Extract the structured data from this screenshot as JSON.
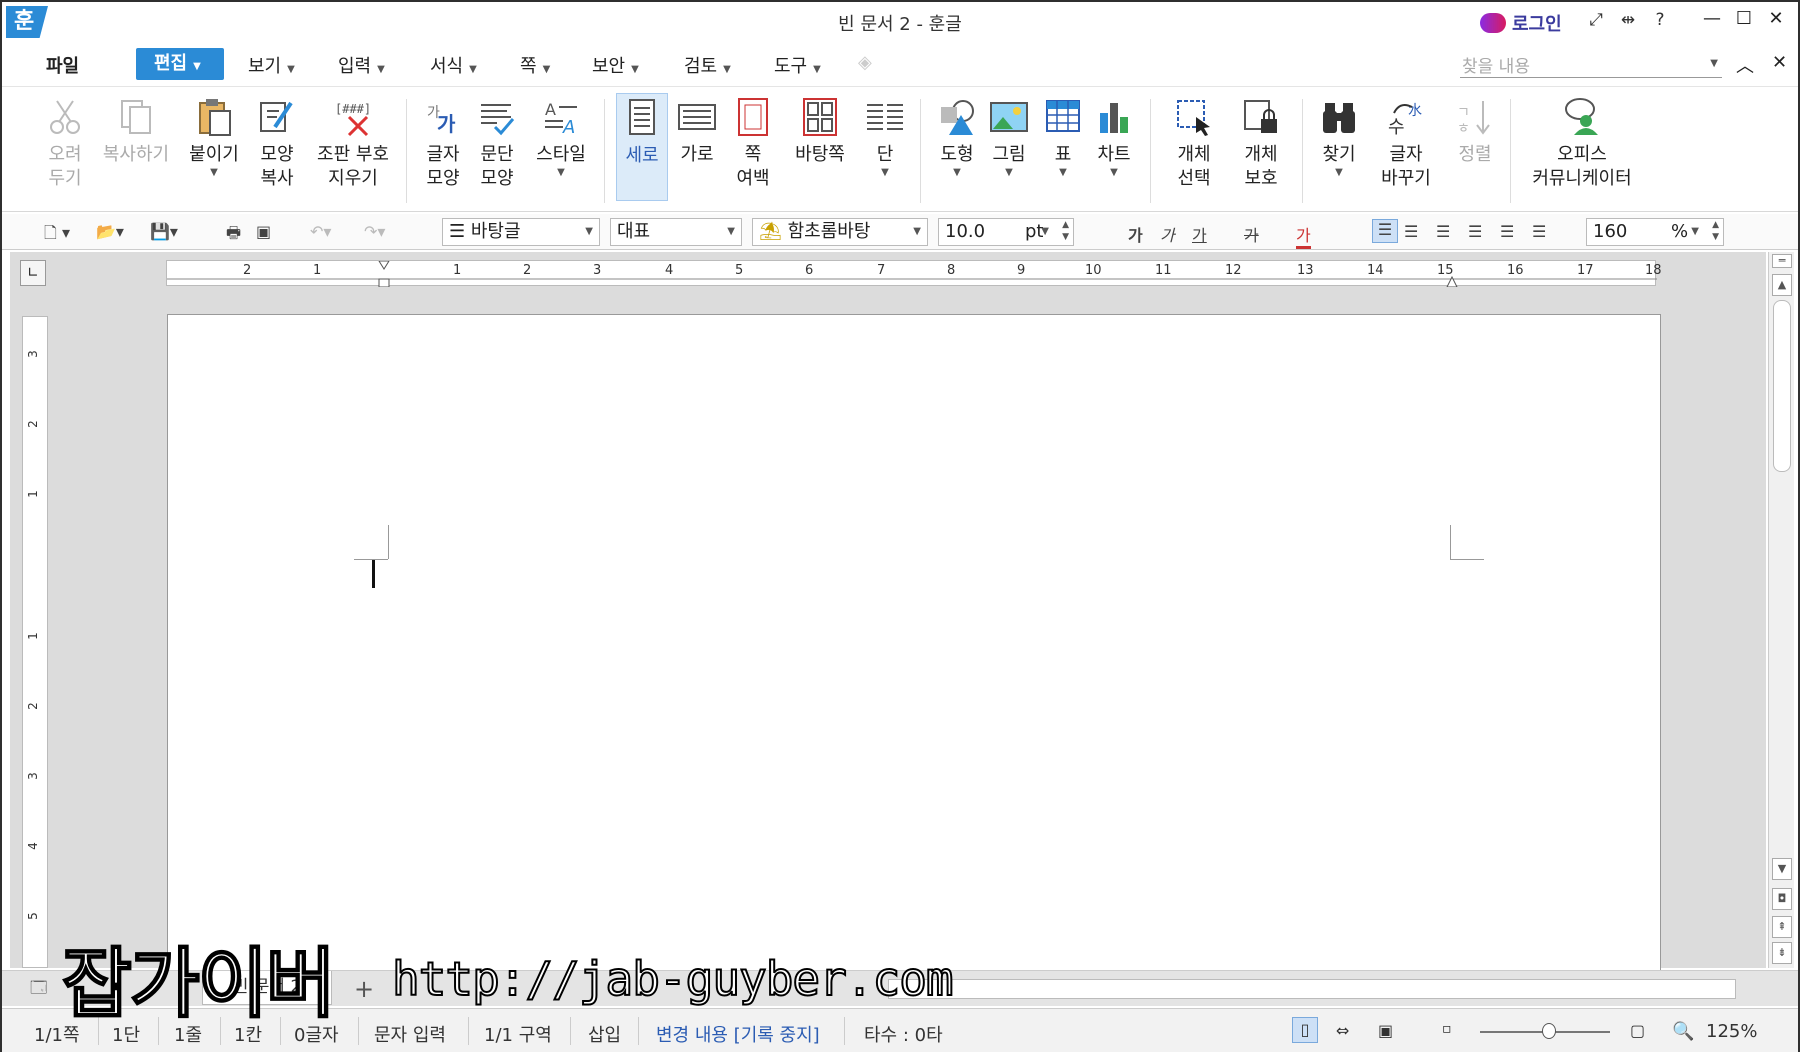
{
  "app": {
    "logo_text": "훈",
    "window_title": "빈 문서 2 - 훈글",
    "login_label": "로그인"
  },
  "title_buttons": [
    "⤢",
    "⇹",
    "?"
  ],
  "window_buttons": [
    "—",
    "☐",
    "✕"
  ],
  "menu": {
    "file": "파일",
    "items": [
      "편집",
      "보기",
      "입력",
      "서식",
      "쪽",
      "보안",
      "검토",
      "도구"
    ],
    "search_placeholder": "찾을 내용",
    "right": [
      "︿",
      "✕"
    ]
  },
  "ribbon": {
    "cut": "오려\n두기",
    "copy": "복사하기",
    "paste": "붙이기",
    "format_copy": "모양\n복사",
    "clear_marks": "조판 부호\n지우기",
    "char_shape": "글자\n모양",
    "para_shape": "문단\n모양",
    "style": "스타일",
    "portrait": "세로",
    "landscape": "가로",
    "page_margin": "쪽\n여백",
    "master_page": "바탕쪽",
    "columns": "단",
    "shape": "도형",
    "picture": "그림",
    "table": "표",
    "chart": "차트",
    "obj_select": "개체\n선택",
    "obj_protect": "개체\n보호",
    "find": "찾기",
    "replace": "글자\n바꾸기",
    "sort": "정렬",
    "office_comm": "오피스\n커뮤니케이터"
  },
  "toolbar": {
    "style_value": "바탕글",
    "lang_value": "대표",
    "font_value": "함초롬바탕",
    "size_value": "10.0",
    "size_unit": "pt",
    "format_buttons": [
      "가",
      "가",
      "가",
      "가",
      "가"
    ],
    "zoom_value": "160",
    "zoom_unit": "%"
  },
  "ruler": {
    "h_ticks": [
      "2",
      "1",
      "1",
      "2",
      "3",
      "4",
      "5",
      "6",
      "7",
      "8",
      "9",
      "10",
      "11",
      "12",
      "13",
      "14",
      "15",
      "16",
      "17",
      "18"
    ],
    "v_ticks": [
      "3",
      "2",
      "1",
      "1",
      "2",
      "3",
      "4",
      "5"
    ]
  },
  "tabs": {
    "doc_tab": "빈 문서 2",
    "add": "+"
  },
  "status": {
    "page": "1/1쪽",
    "column": "1단",
    "line": "1줄",
    "cell": "1칸",
    "chars": "0글자",
    "input_mode": "문자 입력",
    "section": "1/1 구역",
    "insert": "삽입",
    "track_changes": "변경 내용 [기록 중지]",
    "keystrokes": "타수 : 0타",
    "zoom": "125%"
  },
  "watermark": {
    "brand": "잡가이버",
    "url": "http://jab-guyber.com"
  },
  "colors": {
    "accent": "#2b8bd6",
    "status_blue": "#2b5cb3"
  }
}
